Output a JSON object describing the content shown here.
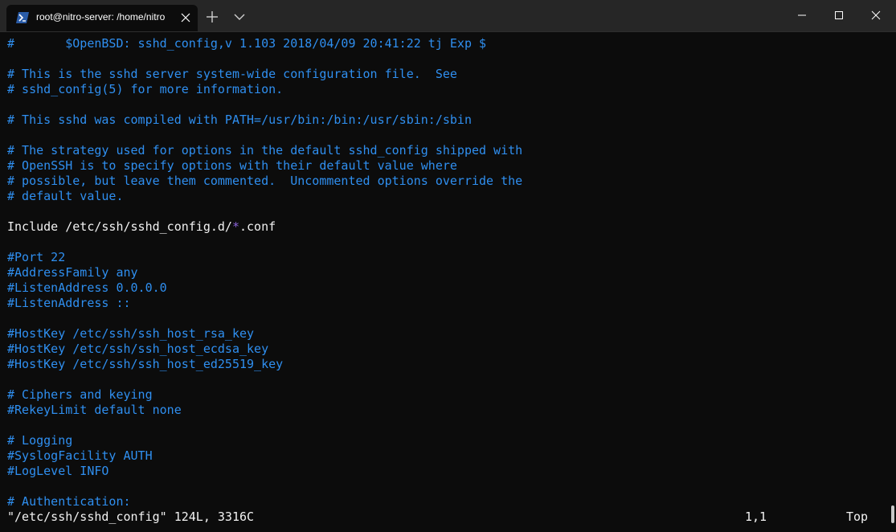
{
  "tab": {
    "icon": "powershell-icon",
    "title": "root@nitro-server: /home/nitro"
  },
  "titlebar_icons": {
    "close_tab": "close-icon",
    "new_tab": "plus-icon",
    "dropdown": "chevron-down-icon",
    "minimize": "minimize-icon",
    "maximize": "maximize-icon",
    "close_window": "close-icon"
  },
  "colors": {
    "background": "#0c0c0c",
    "titlebar": "#262626",
    "comment": "#2f8ff0",
    "text": "#f2f2f2",
    "glob_star": "#8b63d8"
  },
  "lines": {
    "l0": "#\t$OpenBSD: sshd_config,v 1.103 2018/04/09 20:41:22 tj Exp $",
    "l2": "# This is the sshd server system-wide configuration file.  See",
    "l3": "# sshd_config(5) for more information.",
    "l5": "# This sshd was compiled with PATH=/usr/bin:/bin:/usr/sbin:/sbin",
    "l7": "# The strategy used for options in the default sshd_config shipped with",
    "l8": "# OpenSSH is to specify options with their default value where",
    "l9": "# possible, but leave them commented.  Uncommented options override the",
    "l10": "# default value.",
    "l12_a": "Include /etc/ssh/sshd_config.d/",
    "l12_star": "*",
    "l12_b": ".conf",
    "l14": "#Port 22",
    "l15": "#AddressFamily any",
    "l16": "#ListenAddress 0.0.0.0",
    "l17": "#ListenAddress ::",
    "l19": "#HostKey /etc/ssh/ssh_host_rsa_key",
    "l20": "#HostKey /etc/ssh/ssh_host_ecdsa_key",
    "l21": "#HostKey /etc/ssh/ssh_host_ed25519_key",
    "l23": "# Ciphers and keying",
    "l24": "#RekeyLimit default none",
    "l26": "# Logging",
    "l27": "#SyslogFacility AUTH",
    "l28": "#LogLevel INFO",
    "l30": "# Authentication:"
  },
  "status": {
    "file": "\"/etc/ssh/sshd_config\" 124L, 3316C",
    "position": "1,1",
    "scroll": "Top"
  }
}
